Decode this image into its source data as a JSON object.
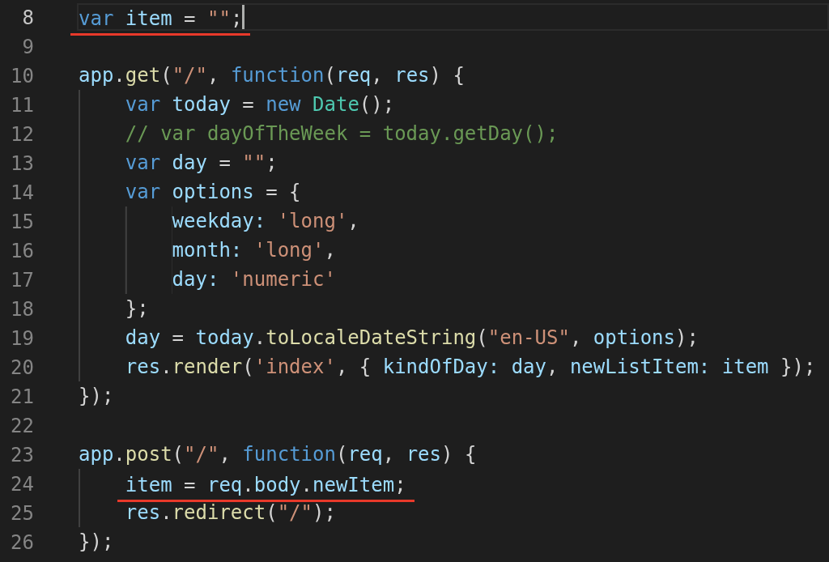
{
  "editor": {
    "lines": [
      {
        "number": "8",
        "current": true,
        "underlined": true,
        "tokens": [
          {
            "text": "var",
            "kind": "keyword"
          },
          {
            "text": " item",
            "kind": "variable"
          },
          {
            "text": " = ",
            "kind": "punct"
          },
          {
            "text": "\"\"",
            "kind": "string"
          },
          {
            "text": ";",
            "kind": "punct"
          }
        ]
      },
      {
        "number": "9",
        "current": false,
        "underlined": false
      },
      {
        "number": "10",
        "current": false,
        "underlined": false,
        "tokens": [
          {
            "text": "app",
            "kind": "variable"
          },
          {
            "text": ".",
            "kind": "punct"
          },
          {
            "text": "get",
            "kind": "function"
          },
          {
            "text": "(",
            "kind": "punct"
          },
          {
            "text": "\"/\"",
            "kind": "string"
          },
          {
            "text": ", ",
            "kind": "punct"
          },
          {
            "text": "function",
            "kind": "keyword"
          },
          {
            "text": "(",
            "kind": "punct"
          },
          {
            "text": "req",
            "kind": "variable"
          },
          {
            "text": ", ",
            "kind": "punct"
          },
          {
            "text": "res",
            "kind": "variable"
          },
          {
            "text": ") {",
            "kind": "punct"
          }
        ]
      },
      {
        "number": "11",
        "current": false,
        "underlined": false,
        "tokens": [
          {
            "text": "    var",
            "kind": "keyword"
          },
          {
            "text": " today",
            "kind": "variable"
          },
          {
            "text": " = ",
            "kind": "punct"
          },
          {
            "text": "new",
            "kind": "keyword"
          },
          {
            "text": " Date",
            "kind": "class"
          },
          {
            "text": "();",
            "kind": "punct"
          }
        ]
      },
      {
        "number": "12",
        "current": false,
        "underlined": false,
        "tokens": [
          {
            "text": "    // var dayOfTheWeek = today.getDay();",
            "kind": "comment"
          }
        ]
      },
      {
        "number": "13",
        "current": false,
        "underlined": false,
        "tokens": [
          {
            "text": "    var",
            "kind": "keyword"
          },
          {
            "text": " day",
            "kind": "variable"
          },
          {
            "text": " = ",
            "kind": "punct"
          },
          {
            "text": "\"\"",
            "kind": "string"
          },
          {
            "text": ";",
            "kind": "punct"
          }
        ]
      },
      {
        "number": "14",
        "current": false,
        "underlined": false,
        "tokens": [
          {
            "text": "    var",
            "kind": "keyword"
          },
          {
            "text": " options",
            "kind": "variable"
          },
          {
            "text": " = {",
            "kind": "punct"
          }
        ]
      },
      {
        "number": "15",
        "current": false,
        "underlined": false,
        "tokens": [
          {
            "text": "        weekday:",
            "kind": "variable"
          },
          {
            "text": " 'long'",
            "kind": "string"
          },
          {
            "text": ",",
            "kind": "punct"
          }
        ]
      },
      {
        "number": "16",
        "current": false,
        "underlined": false,
        "tokens": [
          {
            "text": "        month:",
            "kind": "variable"
          },
          {
            "text": " 'long'",
            "kind": "string"
          },
          {
            "text": ",",
            "kind": "punct"
          }
        ]
      },
      {
        "number": "17",
        "current": false,
        "underlined": false,
        "tokens": [
          {
            "text": "        day:",
            "kind": "variable"
          },
          {
            "text": " 'numeric'",
            "kind": "string"
          }
        ]
      },
      {
        "number": "18",
        "current": false,
        "underlined": false,
        "tokens": [
          {
            "text": "    };",
            "kind": "punct"
          }
        ]
      },
      {
        "number": "19",
        "current": false,
        "underlined": false,
        "tokens": [
          {
            "text": "    day",
            "kind": "variable"
          },
          {
            "text": " = ",
            "kind": "punct"
          },
          {
            "text": "today",
            "kind": "variable"
          },
          {
            "text": ".",
            "kind": "punct"
          },
          {
            "text": "toLocaleDateString",
            "kind": "function"
          },
          {
            "text": "(",
            "kind": "punct"
          },
          {
            "text": "\"en-US\"",
            "kind": "string"
          },
          {
            "text": ", ",
            "kind": "punct"
          },
          {
            "text": "options",
            "kind": "variable"
          },
          {
            "text": ");",
            "kind": "punct"
          }
        ]
      },
      {
        "number": "20",
        "current": false,
        "underlined": false,
        "tokens": [
          {
            "text": "    res",
            "kind": "variable"
          },
          {
            "text": ".",
            "kind": "punct"
          },
          {
            "text": "render",
            "kind": "function"
          },
          {
            "text": "(",
            "kind": "punct"
          },
          {
            "text": "'index'",
            "kind": "string"
          },
          {
            "text": ", { ",
            "kind": "punct"
          },
          {
            "text": "kindOfDay:",
            "kind": "variable"
          },
          {
            "text": " day",
            "kind": "variable"
          },
          {
            "text": ", ",
            "kind": "punct"
          },
          {
            "text": "newListItem:",
            "kind": "variable"
          },
          {
            "text": " item",
            "kind": "variable"
          },
          {
            "text": " });",
            "kind": "punct"
          }
        ]
      },
      {
        "number": "21",
        "current": false,
        "underlined": false,
        "tokens": [
          {
            "text": "});",
            "kind": "punct"
          }
        ]
      },
      {
        "number": "22",
        "current": false,
        "underlined": false
      },
      {
        "number": "23",
        "current": false,
        "underlined": false,
        "tokens": [
          {
            "text": "app",
            "kind": "variable"
          },
          {
            "text": ".",
            "kind": "punct"
          },
          {
            "text": "post",
            "kind": "function"
          },
          {
            "text": "(",
            "kind": "punct"
          },
          {
            "text": "\"/\"",
            "kind": "string"
          },
          {
            "text": ", ",
            "kind": "punct"
          },
          {
            "text": "function",
            "kind": "keyword"
          },
          {
            "text": "(",
            "kind": "punct"
          },
          {
            "text": "req",
            "kind": "variable"
          },
          {
            "text": ", ",
            "kind": "punct"
          },
          {
            "text": "res",
            "kind": "variable"
          },
          {
            "text": ") {",
            "kind": "punct"
          }
        ]
      },
      {
        "number": "24",
        "current": false,
        "underlined": true,
        "tokens": [
          {
            "text": "    item",
            "kind": "variable"
          },
          {
            "text": " = ",
            "kind": "punct"
          },
          {
            "text": "req",
            "kind": "variable"
          },
          {
            "text": ".",
            "kind": "punct"
          },
          {
            "text": "body",
            "kind": "variable"
          },
          {
            "text": ".",
            "kind": "punct"
          },
          {
            "text": "newItem",
            "kind": "variable"
          },
          {
            "text": ";",
            "kind": "punct"
          }
        ]
      },
      {
        "number": "25",
        "current": false,
        "underlined": false,
        "tokens": [
          {
            "text": "    res",
            "kind": "variable"
          },
          {
            "text": ".",
            "kind": "punct"
          },
          {
            "text": "redirect",
            "kind": "function"
          },
          {
            "text": "(",
            "kind": "punct"
          },
          {
            "text": "\"/\"",
            "kind": "string"
          },
          {
            "text": ");",
            "kind": "punct"
          }
        ]
      },
      {
        "number": "26",
        "current": false,
        "underlined": false,
        "tokens": [
          {
            "text": "});",
            "kind": "punct"
          }
        ]
      }
    ]
  }
}
